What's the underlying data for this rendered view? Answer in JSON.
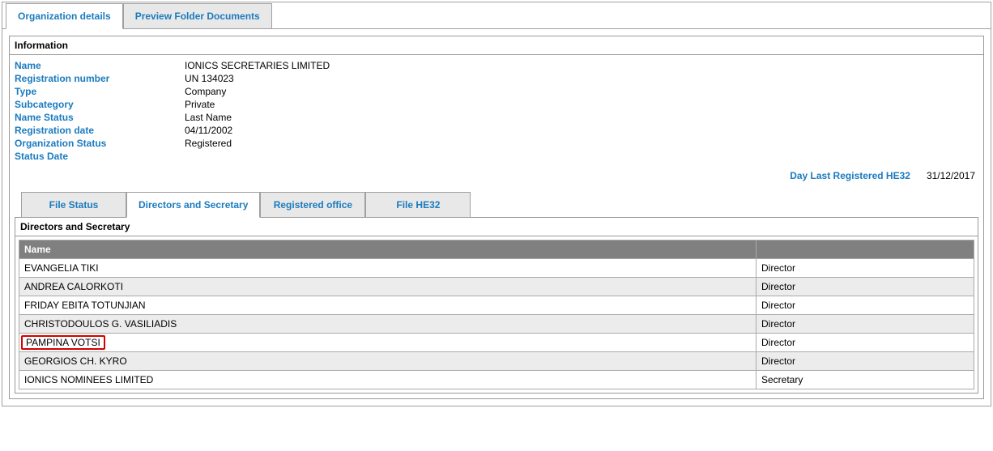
{
  "tabs": {
    "org_details": "Organization details",
    "preview_docs": "Preview Folder Documents"
  },
  "info_header": "Information",
  "info": {
    "name_label": "Name",
    "name_value": "IONICS SECRETARIES LIMITED",
    "reg_num_label": "Registration number",
    "reg_num_value": "UN 134023",
    "type_label": "Type",
    "type_value": "Company",
    "subcat_label": "Subcategory",
    "subcat_value": "Private",
    "name_status_label": "Name Status",
    "name_status_value": "Last Name",
    "reg_date_label": "Registration date",
    "reg_date_value": "04/11/2002",
    "org_status_label": "Organization Status",
    "org_status_value": "Registered",
    "status_date_label": "Status Date",
    "status_date_value": ""
  },
  "day_last": {
    "label": "Day Last Registered HE32",
    "value": "31/12/2017"
  },
  "sub_tabs": {
    "file_status": "File Status",
    "directors": "Directors and Secretary",
    "reg_office": "Registered office",
    "file_he32": "File HE32"
  },
  "subsection_header": "Directors and Secretary",
  "table": {
    "col_name": "Name",
    "col_role": "",
    "rows": [
      {
        "name": "EVANGELIA TIKI",
        "role": "Director",
        "highlight": false
      },
      {
        "name": "ANDREA CALORKOTI",
        "role": "Director",
        "highlight": false
      },
      {
        "name": "FRIDAY EBITA TOTUNJIAN",
        "role": "Director",
        "highlight": false
      },
      {
        "name": "CHRISTODOULOS G. VASILIADIS",
        "role": "Director",
        "highlight": false
      },
      {
        "name": "PAMPINA VOTSI",
        "role": "Director",
        "highlight": true
      },
      {
        "name": "GEORGIOS CH. KYRO",
        "role": "Director",
        "highlight": false
      },
      {
        "name": "IONICS NOMINEES LIMITED",
        "role": "Secretary",
        "highlight": false
      }
    ]
  }
}
